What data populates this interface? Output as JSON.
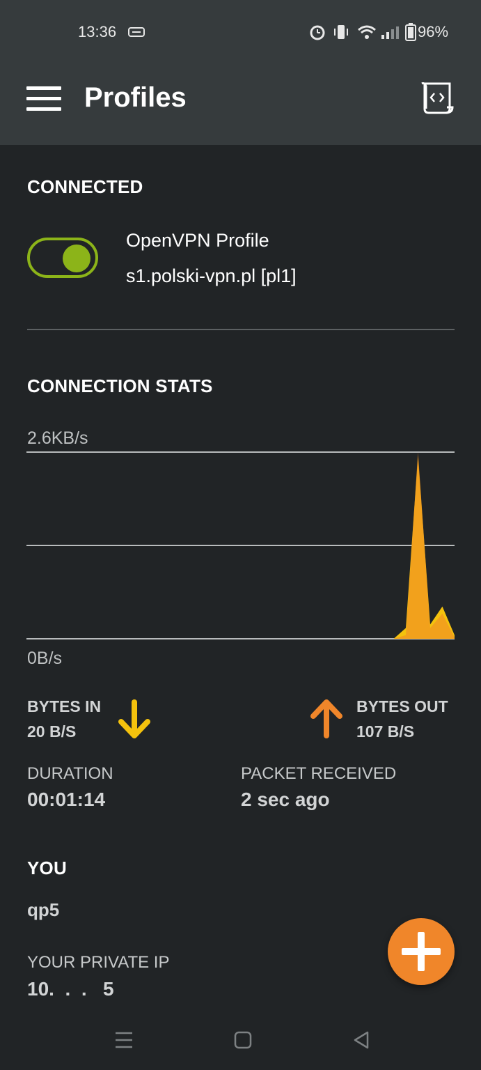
{
  "status_bar": {
    "time": "13:36",
    "battery": "96%",
    "icons": [
      "message-icon",
      "alarm-icon",
      "vibrate-icon",
      "wifi-icon",
      "signal-icon",
      "battery-icon"
    ]
  },
  "app_bar": {
    "title": "Profiles",
    "menu_icon": "hamburger-menu-icon",
    "log_icon": "log-scroll-icon"
  },
  "connected_section": {
    "title": "CONNECTED",
    "toggle_on": true,
    "profile_name": "OpenVPN Profile",
    "server": "s1.polski-vpn.pl [pl1]"
  },
  "stats_section": {
    "title": "CONNECTION STATS",
    "max_label": "2.6KB/s",
    "min_label": "0B/s",
    "bytes_in_label": "BYTES IN",
    "bytes_in_value": "20 B/S",
    "bytes_out_label": "BYTES OUT",
    "bytes_out_value": "107 B/S",
    "duration_label": "DURATION",
    "duration_value": "00:01:14",
    "packet_label": "PACKET RECEIVED",
    "packet_value": "2 sec ago"
  },
  "chart_data": {
    "type": "area",
    "ylim": [
      0,
      2.6
    ],
    "y_unit": "KB/s",
    "grid": true,
    "series": [
      {
        "color": "#f4c20d",
        "x": [
          0,
          1,
          2,
          3,
          4,
          5,
          6,
          7,
          8,
          9,
          10,
          11,
          12,
          13,
          14,
          15,
          16,
          17,
          18,
          19,
          20,
          21,
          22,
          23,
          24,
          25,
          26,
          27,
          28,
          29,
          30,
          31,
          32,
          33,
          34,
          35,
          36,
          37,
          38,
          39,
          40
        ],
        "values": [
          0,
          0,
          0,
          0,
          0,
          0,
          0,
          0,
          0,
          0,
          0,
          0,
          0,
          0,
          0,
          0,
          0,
          0,
          0,
          0,
          0,
          0,
          0,
          0,
          0,
          0,
          0,
          0,
          0,
          0,
          0,
          0,
          0,
          0,
          0,
          0,
          0.15,
          2.55,
          0.2,
          0.45,
          0.05
        ]
      },
      {
        "color": "#f0862a",
        "x": [
          0,
          1,
          2,
          3,
          4,
          5,
          6,
          7,
          8,
          9,
          10,
          11,
          12,
          13,
          14,
          15,
          16,
          17,
          18,
          19,
          20,
          21,
          22,
          23,
          24,
          25,
          26,
          27,
          28,
          29,
          30,
          31,
          32,
          33,
          34,
          35,
          36,
          37,
          38,
          39,
          40
        ],
        "values": [
          0,
          0,
          0,
          0,
          0,
          0,
          0,
          0,
          0,
          0,
          0,
          0,
          0,
          0,
          0,
          0,
          0,
          0,
          0,
          0,
          0,
          0,
          0,
          0,
          0,
          0,
          0,
          0,
          0,
          0,
          0,
          0,
          0,
          0,
          0,
          0,
          0.05,
          2.6,
          0.15,
          0.35,
          0.02
        ]
      }
    ]
  },
  "you_section": {
    "title": "YOU",
    "user": "qp5",
    "private_ip_label": "YOUR PRIVATE IP",
    "private_ip_value": "10.  .  .   5"
  },
  "fab": {
    "icon": "plus-icon",
    "color": "#f0862a"
  },
  "nav_bar": {
    "icons": [
      "recent-apps-icon",
      "home-icon",
      "back-icon"
    ]
  }
}
